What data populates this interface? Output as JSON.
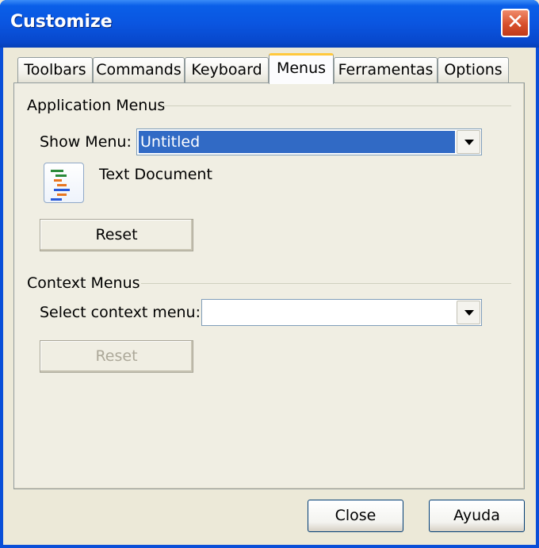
{
  "window": {
    "title": "Customize"
  },
  "tabs": [
    {
      "label": "Toolbars",
      "active": false
    },
    {
      "label": "Commands",
      "active": false
    },
    {
      "label": "Keyboard",
      "active": false
    },
    {
      "label": "Menus",
      "active": true
    },
    {
      "label": "Ferramentas",
      "active": false
    },
    {
      "label": "Options",
      "active": false
    }
  ],
  "application_menus": {
    "group_label": "Application Menus",
    "show_menu_label": "Show Menu:",
    "show_menu_value": "Untitled",
    "document_label": "Text Document",
    "document_icon": "text-document-icon",
    "reset_label": "Reset"
  },
  "context_menus": {
    "group_label": "Context Menus",
    "select_label": "Select context menu:",
    "select_value": "",
    "reset_label": "Reset"
  },
  "footer": {
    "close_label": "Close",
    "help_label": "Ayuda"
  },
  "colors": {
    "title_bar": "#0a55e0",
    "selection": "#316ac5",
    "close_button": "#d8502c",
    "active_tab_accent": "#ffc83c"
  }
}
